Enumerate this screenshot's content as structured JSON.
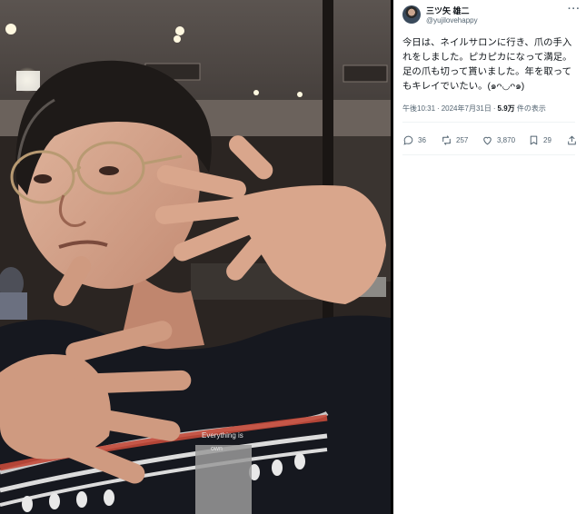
{
  "tweet": {
    "display_name": "三ツ矢 雄二",
    "handle": "@yujilovehappy",
    "more_label": "···",
    "text": "今日は、ネイルサロンに行き、爪の手入れをしました。ピカピカになって満足。足の爪も切って貰いました。年を取ってもキレイでいたい。(๑ᴖ◡ᴖ๑)",
    "time": "午後10:31",
    "date": "2024年7月31日",
    "views_count": "5.9万",
    "views_label": "件の表示",
    "replies": "36",
    "reposts": "257",
    "likes": "3,870",
    "bookmarks": "29"
  },
  "photo": {
    "shirt_print_text": "Everything is",
    "shirt_print_text2": "own"
  },
  "icons": {
    "reply": "reply-icon",
    "repost": "repost-icon",
    "like": "heart-icon",
    "bookmark": "bookmark-icon",
    "share": "share-icon"
  }
}
